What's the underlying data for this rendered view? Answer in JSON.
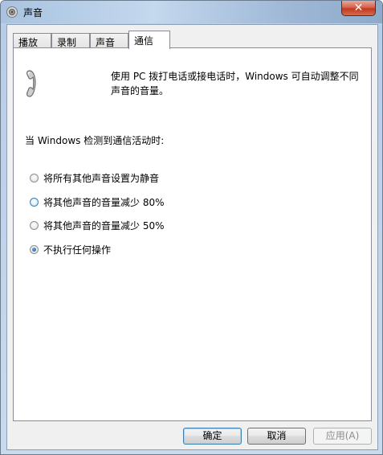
{
  "window": {
    "title": "声音",
    "close_label": "✕"
  },
  "tabs": [
    {
      "label": "播放"
    },
    {
      "label": "录制"
    },
    {
      "label": "声音"
    },
    {
      "label": "通信"
    }
  ],
  "active_tab": "通信",
  "communications": {
    "icon": "telephone-handset-icon",
    "description": "使用 PC 拨打电话或接电话时，Windows 可自动调整不同声音的音量。",
    "prompt": "当 Windows 检测到通信活动时:",
    "options": [
      {
        "label": "将所有其他声音设置为静音",
        "checked": false
      },
      {
        "label": "将其他声音的音量减少 80%",
        "checked": false
      },
      {
        "label": "将其他声音的音量减少 50%",
        "checked": false
      },
      {
        "label": "不执行任何操作",
        "checked": true
      }
    ]
  },
  "buttons": {
    "ok": "确定",
    "cancel": "取消",
    "apply": "应用(A)"
  },
  "colors": {
    "titlebar": "#b7cde6",
    "close_button": "#c2391e",
    "focus_border": "#3c7fb1"
  }
}
